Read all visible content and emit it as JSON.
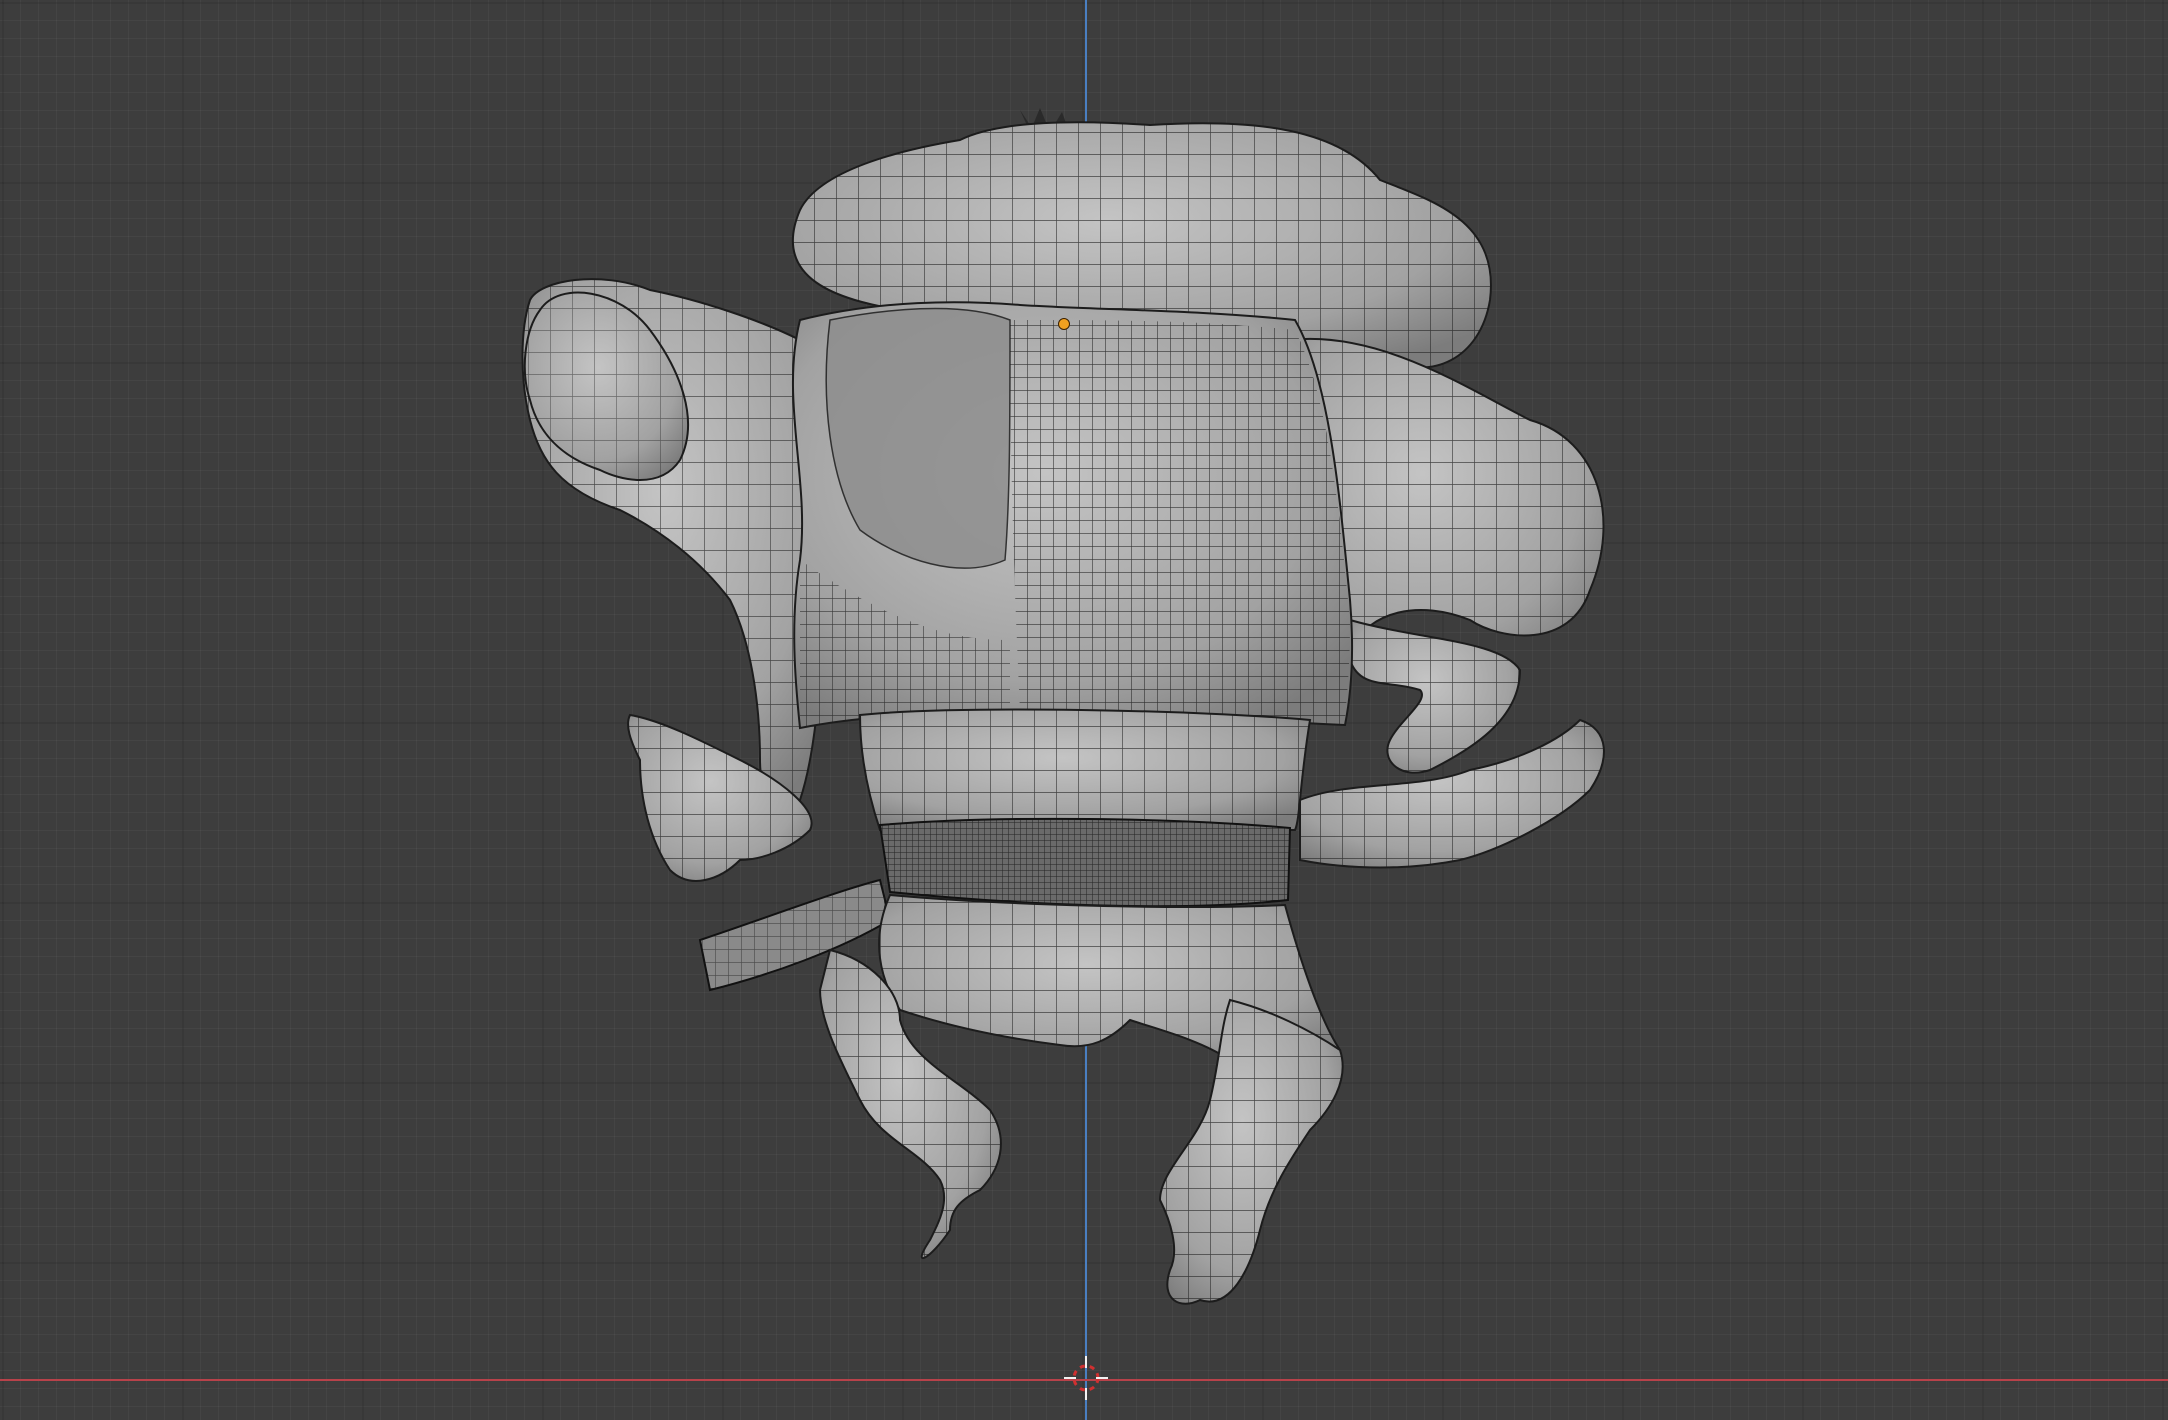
{
  "viewport": {
    "background_color": "#3d3d3d",
    "axis_y_color": "#4a7fc1",
    "axis_x_color": "#b8424a",
    "origin_color": "#f0a020",
    "cursor_color_a": "#d03030",
    "cursor_color_b": "#f2f2f2",
    "mesh_fill": "#a8a8a8",
    "mesh_wire": "#1c1c1c"
  },
  "icons": {
    "cursor": "3d-cursor-icon",
    "origin": "object-origin-icon"
  }
}
